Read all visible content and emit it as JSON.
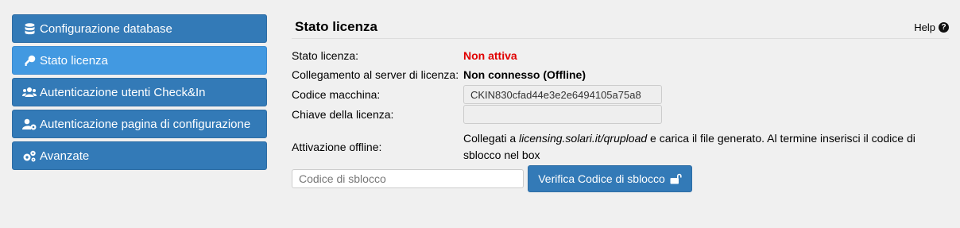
{
  "sidebar": {
    "items": [
      {
        "label": "Configurazione database",
        "icon": "database-icon"
      },
      {
        "label": "Stato licenza",
        "icon": "key-icon",
        "active": true
      },
      {
        "label": "Autenticazione utenti Check&In",
        "icon": "users-icon"
      },
      {
        "label": "Autenticazione pagina di configurazione",
        "icon": "user-gear-icon"
      },
      {
        "label": "Avanzate",
        "icon": "gears-icon"
      }
    ]
  },
  "main": {
    "title": "Stato licenza",
    "help_label": "Help",
    "help_icon": "?",
    "status_label": "Stato licenza:",
    "status_value": "Non attiva",
    "connection_label": "Collegamento al server di licenza:",
    "connection_value": "Non connesso (Offline)",
    "machine_code_label": "Codice macchina:",
    "machine_code_value": "CKIN830cfad44e3e2e6494105a75a8",
    "license_key_label": "Chiave della licenza:",
    "license_key_value": "",
    "offline_label": "Attivazione offline:",
    "offline_text_before": "Collegati a ",
    "offline_link": "licensing.solari.it/qrupload",
    "offline_text_after": " e carica il file generato. Al termine inserisci il codice di sblocco nel box",
    "unlock_placeholder": "Codice di sblocco",
    "verify_button": "Verifica Codice di sblocco"
  },
  "colors": {
    "primary": "#337ab7",
    "active": "#4299e1",
    "status_red": "#e00000",
    "background": "#f0f0f0"
  }
}
